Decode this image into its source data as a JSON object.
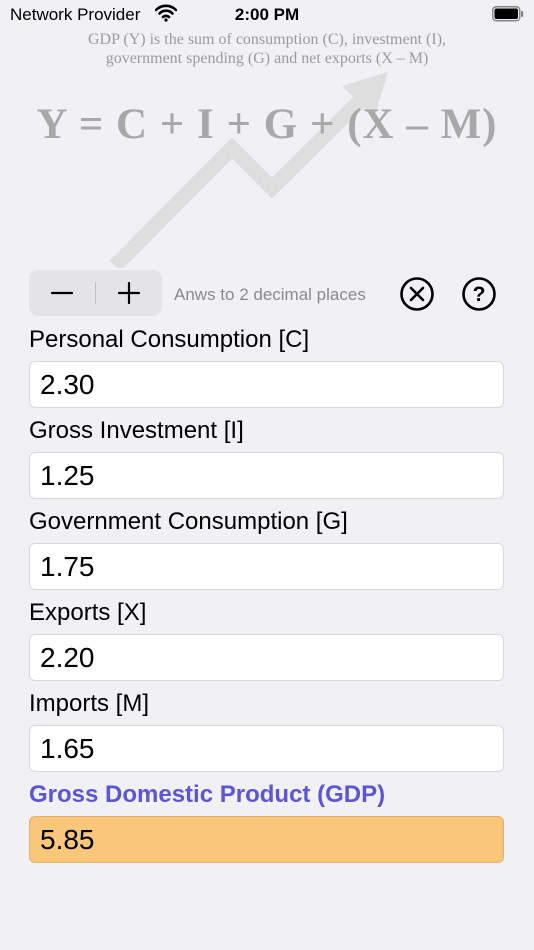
{
  "status_bar": {
    "carrier": "Network Provider",
    "time": "2:00 PM"
  },
  "banner": {
    "caption_line1": "GDP (Y) is the sum of consumption (C), investment (I),",
    "caption_line2": "government spending (G) and net exports (X – M)",
    "formula": "Y = C + I + G + (X – M)"
  },
  "controls": {
    "minus_label": "−",
    "plus_label": "+",
    "hint": "Anws to 2 decimal places",
    "clear_icon": "x-circle-icon",
    "help_icon": "question-circle-icon"
  },
  "fields": [
    {
      "label": "Personal Consumption [C]",
      "value": "2.30"
    },
    {
      "label": "Gross Investment [I]",
      "value": "1.25"
    },
    {
      "label": "Government Consumption [G]",
      "value": "1.75"
    },
    {
      "label": "Exports [X]",
      "value": "2.20"
    },
    {
      "label": "Imports [M]",
      "value": "1.65"
    }
  ],
  "result": {
    "label": "Gross Domestic Product (GDP)",
    "value": "5.85"
  },
  "colors": {
    "background": "#f1f0f5",
    "result_label": "#5c55d6",
    "result_field": "#f9c67a",
    "hint_text": "#8a8a8e"
  }
}
